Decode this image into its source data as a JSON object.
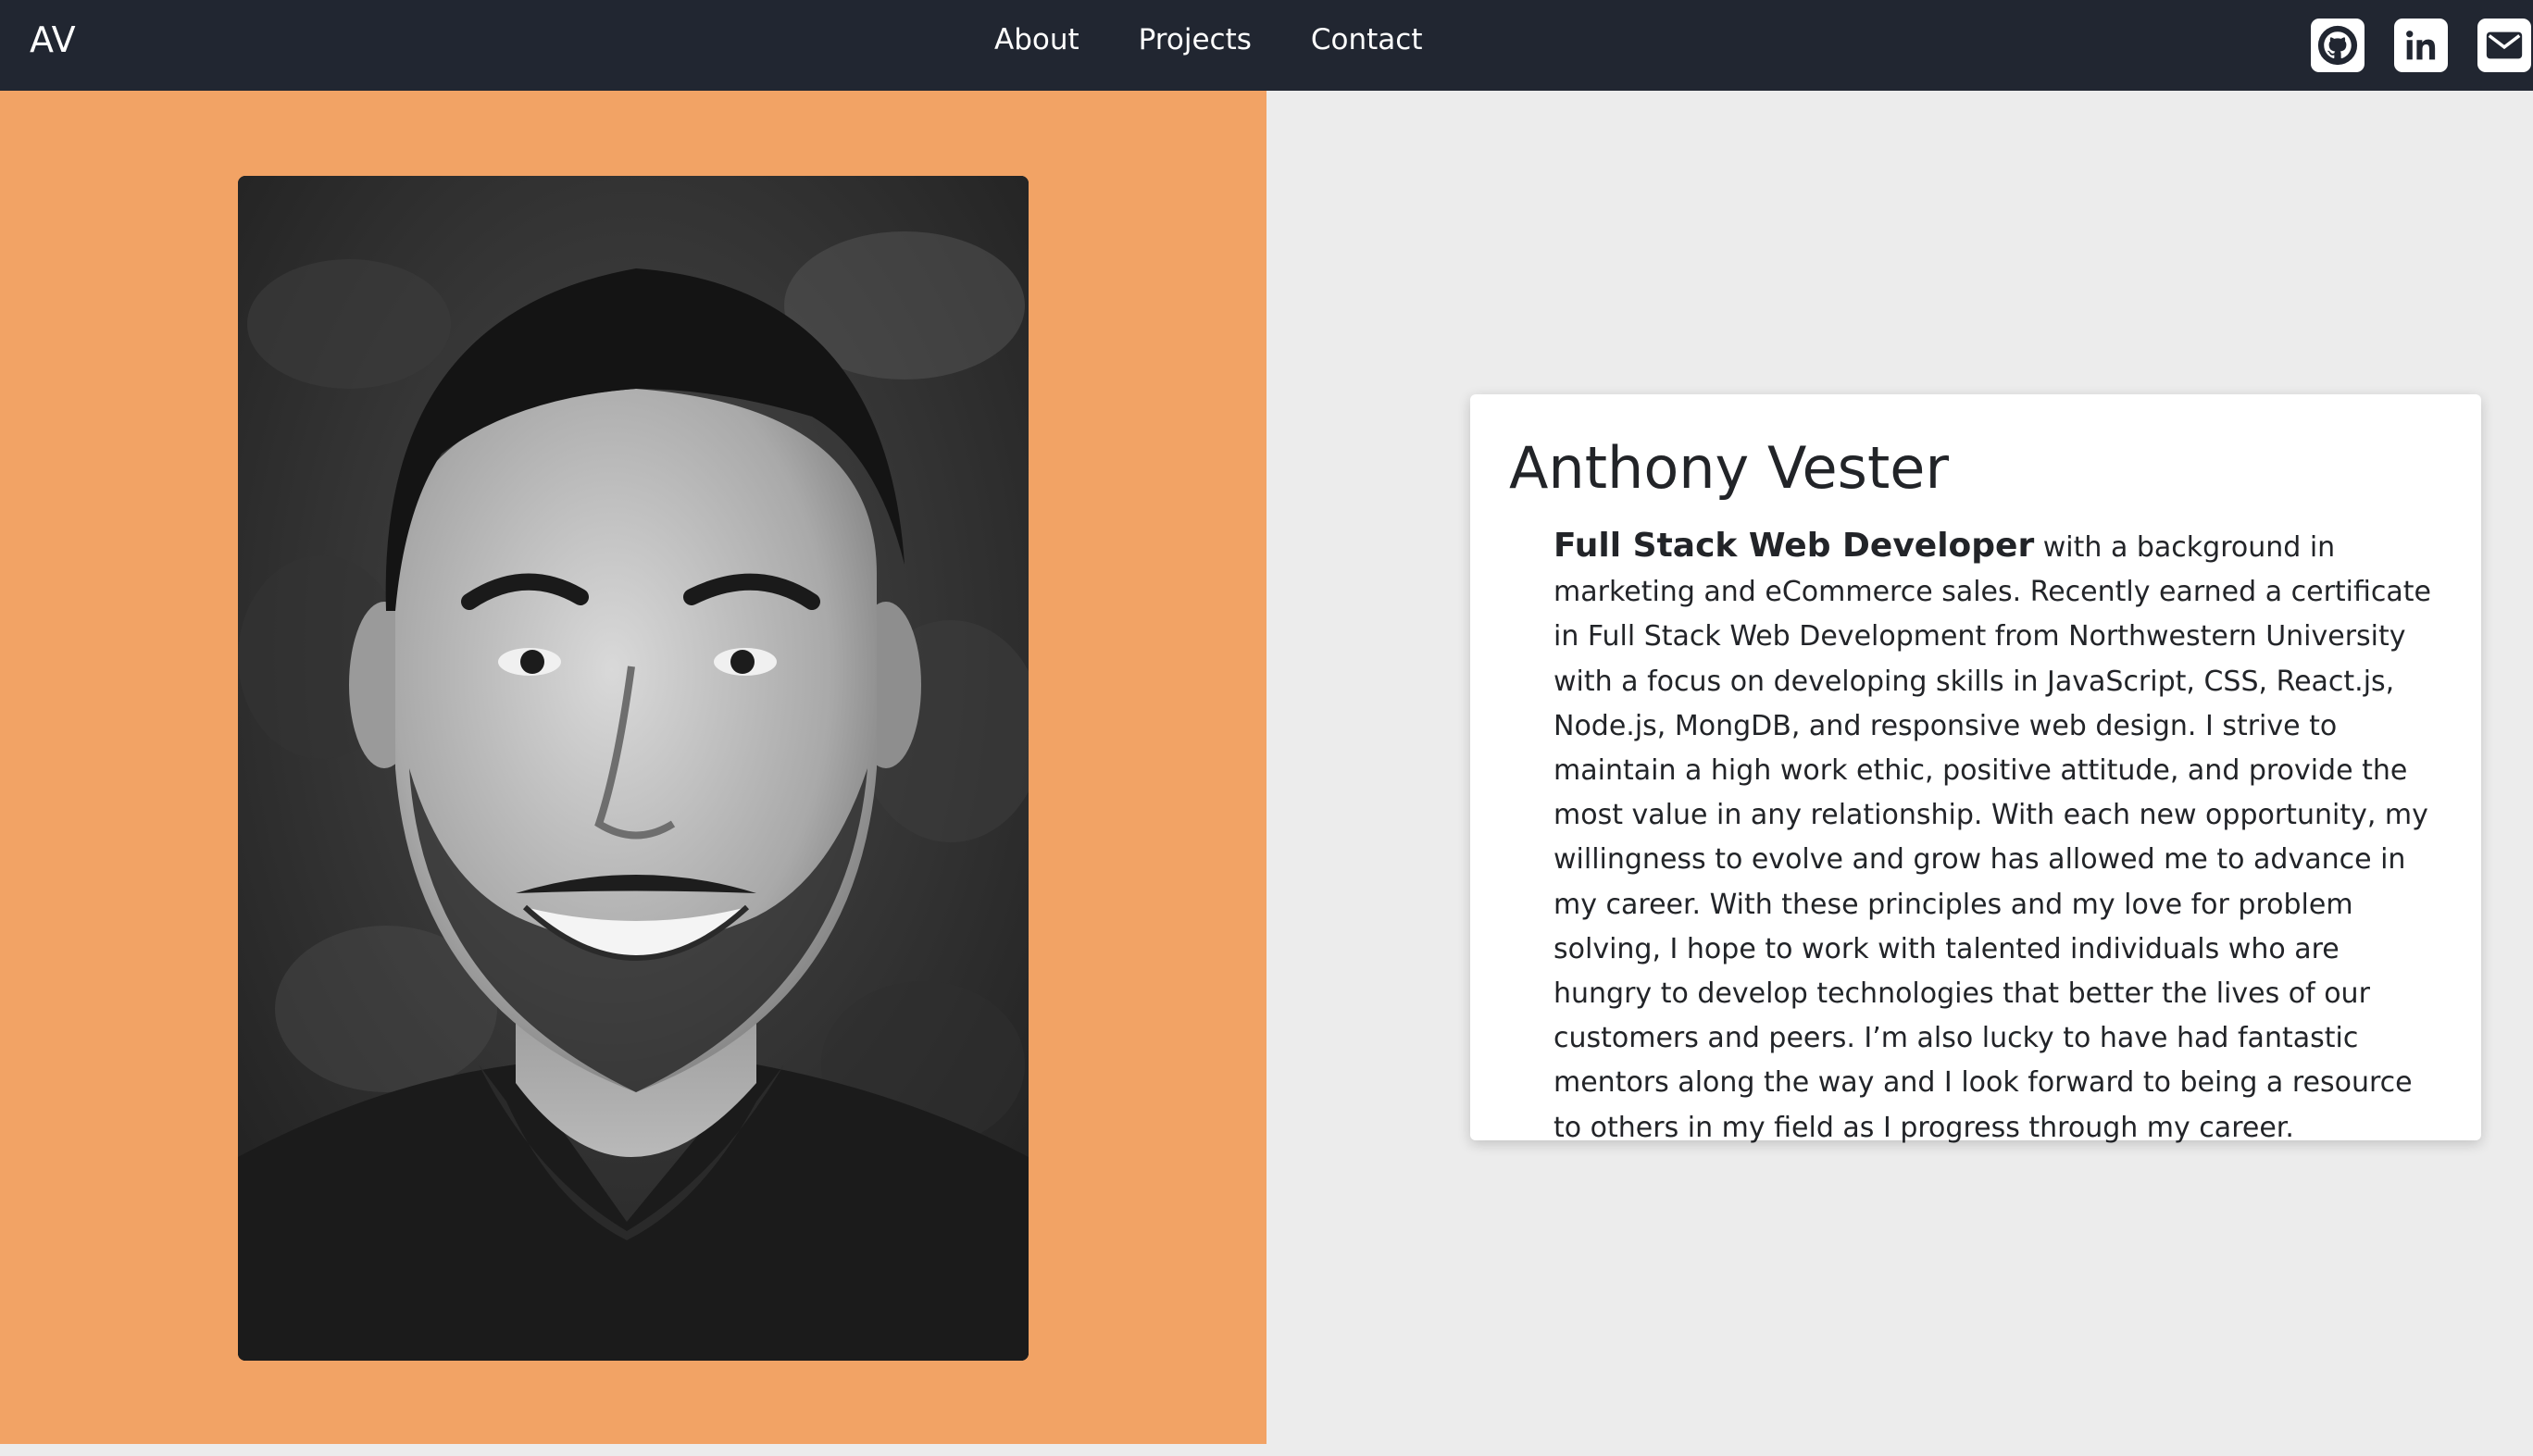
{
  "navbar": {
    "brand": "AV",
    "links": [
      "About",
      "Projects",
      "Contact"
    ],
    "social": [
      "github-icon",
      "linkedin-icon",
      "envelope-icon"
    ]
  },
  "colors": {
    "navbar_bg": "#212631",
    "left_panel_bg": "#f2a365",
    "page_bg": "#ececec",
    "card_bg": "#ffffff",
    "text": "#222428"
  },
  "profile": {
    "photo": "black-and-white-portrait",
    "name": "Anthony Vester",
    "title": "Full Stack Web Developer",
    "bio": " with a background in marketing and eCommerce sales. Recently earned a certificate in Full Stack Web Development from Northwestern University with a focus on developing skills in JavaScript, CSS, React.js, Node.js, MongDB, and responsive web design. I strive to maintain a high work ethic, positive attitude, and provide the most value in any relationship. With each new opportunity, my willingness to evolve and grow has allowed me to advance in my career. With these principles and my love for problem solving, I hope to work with talented individuals who are hungry to develop technologies that better the lives of our customers and peers. I’m also lucky to have had fantastic mentors along the way and I look forward to being a resource to others in my field as I progress through my career."
  }
}
